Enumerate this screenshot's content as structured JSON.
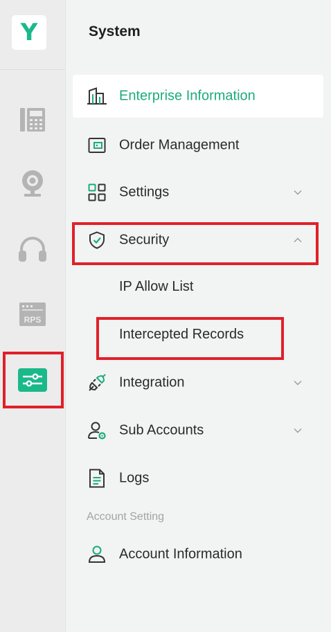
{
  "app": {
    "logo_letter": "Y"
  },
  "rail": {
    "icons": [
      {
        "name": "phone-icon"
      },
      {
        "name": "webcam-icon"
      },
      {
        "name": "headset-icon"
      },
      {
        "name": "rps-icon",
        "label": "RPS"
      },
      {
        "name": "system-settings-icon",
        "active": true
      }
    ]
  },
  "menu": {
    "title": "System",
    "items": [
      {
        "label": "Enterprise Information",
        "icon": "building-icon",
        "active": true
      },
      {
        "label": "Order Management",
        "icon": "wallet-icon"
      },
      {
        "label": "Settings",
        "icon": "grid-icon",
        "chevron": "down"
      },
      {
        "label": "Security",
        "icon": "shield-check-icon",
        "chevron": "up",
        "expanded": true
      },
      {
        "label": "Integration",
        "icon": "plug-icon",
        "chevron": "down"
      },
      {
        "label": "Sub Accounts",
        "icon": "user-gear-icon",
        "chevron": "down"
      },
      {
        "label": "Logs",
        "icon": "document-icon"
      }
    ],
    "security_subitems": [
      {
        "label": "IP Allow List"
      },
      {
        "label": "Intercepted Records"
      }
    ],
    "account_section": {
      "label": "Account Setting",
      "items": [
        {
          "label": "Account Information",
          "icon": "user-icon"
        }
      ]
    }
  },
  "colors": {
    "accent": "#1bab7d",
    "highlight": "#e0202a",
    "rail_icon": "#b4b4b4"
  }
}
